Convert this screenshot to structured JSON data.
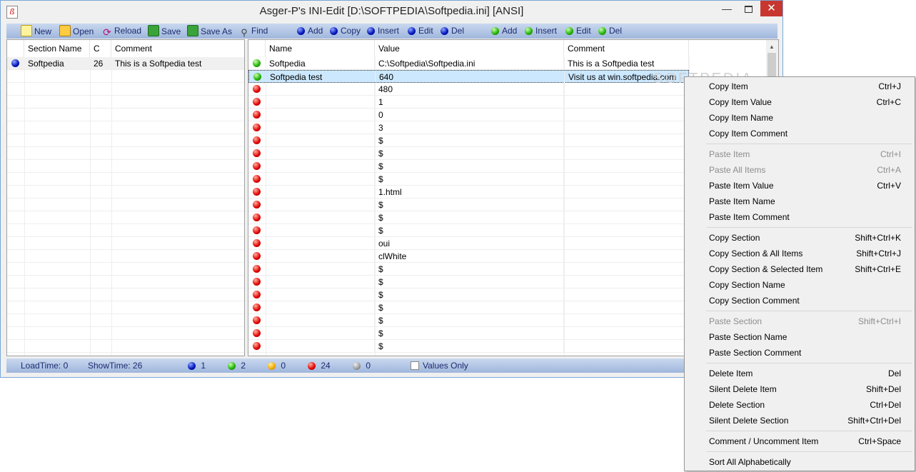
{
  "window": {
    "title": "Asger-P's INI-Edit   [D:\\SOFTPEDIA\\Softpedia.ini] [ANSI]",
    "app_icon": "ß",
    "min": "—",
    "close": "✕"
  },
  "toolbar": {
    "new": "New",
    "open": "Open",
    "reload": "Reload",
    "save": "Save",
    "save_as": "Save As",
    "find": "Find",
    "section_add": "Add",
    "section_copy": "Copy",
    "section_insert": "Insert",
    "section_edit": "Edit",
    "section_del": "Del",
    "item_add": "Add",
    "item_insert": "Insert",
    "item_edit": "Edit",
    "item_del": "Del"
  },
  "sections": {
    "headers": [
      "Section Name",
      "C",
      "Comment"
    ],
    "rows": [
      {
        "name": "Softpedia",
        "count": "26",
        "comment": "This is a Softpedia test"
      }
    ]
  },
  "items": {
    "headers": [
      "Name",
      "Value",
      "Comment"
    ],
    "rows": [
      {
        "status": "green",
        "name": "Softpedia",
        "value": "C:\\Softpedia\\Softpedia.ini",
        "comment": "This is a Softpedia test"
      },
      {
        "status": "green",
        "name": "Softpedia test",
        "value": "640",
        "comment": "Visit us at win.softpedia.com"
      },
      {
        "status": "red",
        "name": "",
        "value": "480",
        "comment": ""
      },
      {
        "status": "red",
        "name": "",
        "value": "1",
        "comment": ""
      },
      {
        "status": "red",
        "name": "",
        "value": "0",
        "comment": ""
      },
      {
        "status": "red",
        "name": "",
        "value": "3",
        "comment": ""
      },
      {
        "status": "red",
        "name": "",
        "value": "$",
        "comment": ""
      },
      {
        "status": "red",
        "name": "",
        "value": "$",
        "comment": ""
      },
      {
        "status": "red",
        "name": "",
        "value": "$",
        "comment": ""
      },
      {
        "status": "red",
        "name": "",
        "value": "$",
        "comment": ""
      },
      {
        "status": "red",
        "name": "",
        "value": "1.html",
        "comment": ""
      },
      {
        "status": "red",
        "name": "",
        "value": "$",
        "comment": ""
      },
      {
        "status": "red",
        "name": "",
        "value": "$",
        "comment": ""
      },
      {
        "status": "red",
        "name": "",
        "value": "$",
        "comment": ""
      },
      {
        "status": "red",
        "name": "",
        "value": "oui",
        "comment": ""
      },
      {
        "status": "red",
        "name": "",
        "value": "clWhite",
        "comment": ""
      },
      {
        "status": "red",
        "name": "",
        "value": "$",
        "comment": ""
      },
      {
        "status": "red",
        "name": "",
        "value": "$",
        "comment": ""
      },
      {
        "status": "red",
        "name": "",
        "value": "$",
        "comment": ""
      },
      {
        "status": "red",
        "name": "",
        "value": "$",
        "comment": ""
      },
      {
        "status": "red",
        "name": "",
        "value": "$",
        "comment": ""
      },
      {
        "status": "red",
        "name": "",
        "value": "$",
        "comment": ""
      },
      {
        "status": "red",
        "name": "",
        "value": "$",
        "comment": ""
      }
    ]
  },
  "status": {
    "load_time": "LoadTime:  0",
    "show_time": "ShowTime:  26",
    "blue_count": "1",
    "green_count": "2",
    "yellow_count": "0",
    "red_count": "24",
    "gray_count": "0",
    "values_only": "Values Only"
  },
  "watermark": "SOFTPEDIA",
  "context_menu": {
    "groups": [
      [
        {
          "label": "Copy Item",
          "shortcut": "Ctrl+J",
          "enabled": true
        },
        {
          "label": "Copy Item Value",
          "shortcut": "Ctrl+C",
          "enabled": true
        },
        {
          "label": "Copy Item Name",
          "shortcut": "",
          "enabled": true
        },
        {
          "label": "Copy Item Comment",
          "shortcut": "",
          "enabled": true
        }
      ],
      [
        {
          "label": "Paste Item",
          "shortcut": "Ctrl+I",
          "enabled": false
        },
        {
          "label": "Paste All Items",
          "shortcut": "Ctrl+A",
          "enabled": false
        },
        {
          "label": "Paste Item Value",
          "shortcut": "Ctrl+V",
          "enabled": true
        },
        {
          "label": "Paste Item Name",
          "shortcut": "",
          "enabled": true
        },
        {
          "label": "Paste Item Comment",
          "shortcut": "",
          "enabled": true
        }
      ],
      [
        {
          "label": "Copy Section",
          "shortcut": "Shift+Ctrl+K",
          "enabled": true
        },
        {
          "label": "Copy Section & All Items",
          "shortcut": "Shift+Ctrl+J",
          "enabled": true
        },
        {
          "label": "Copy Section & Selected Item",
          "shortcut": "Shift+Ctrl+E",
          "enabled": true
        },
        {
          "label": "Copy Section Name",
          "shortcut": "",
          "enabled": true
        },
        {
          "label": "Copy Section Comment",
          "shortcut": "",
          "enabled": true
        }
      ],
      [
        {
          "label": "Paste Section",
          "shortcut": "Shift+Ctrl+I",
          "enabled": false
        },
        {
          "label": "Paste Section Name",
          "shortcut": "",
          "enabled": true
        },
        {
          "label": "Paste Section Comment",
          "shortcut": "",
          "enabled": true
        }
      ],
      [
        {
          "label": "Delete Item",
          "shortcut": "Del",
          "enabled": true
        },
        {
          "label": "Silent Delete Item",
          "shortcut": "Shift+Del",
          "enabled": true
        },
        {
          "label": "Delete Section",
          "shortcut": "Ctrl+Del",
          "enabled": true
        },
        {
          "label": "Silent Delete Section",
          "shortcut": "Shift+Ctrl+Del",
          "enabled": true
        }
      ],
      [
        {
          "label": "Comment / Uncomment Item",
          "shortcut": "Ctrl+Space",
          "enabled": true
        }
      ],
      [
        {
          "label": "Sort All Alphabetically",
          "shortcut": "",
          "enabled": true
        }
      ]
    ]
  }
}
